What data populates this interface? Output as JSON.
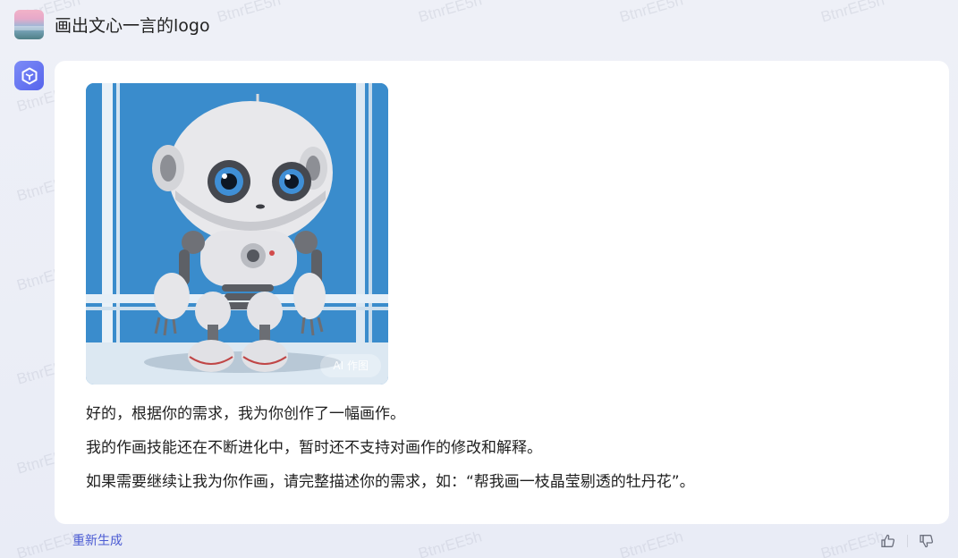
{
  "watermark": {
    "text": "BtnrEE5h"
  },
  "user_message": {
    "text": "画出文心一言的logo"
  },
  "bot_message": {
    "image_badge": "AI 作图",
    "paragraphs": [
      "好的，根据你的需求，我为你创作了一幅画作。",
      "我的作画技能还在不断进化中，暂时还不支持对画作的修改和解释。",
      "如果需要继续让我为你作画，请完整描述你的需求，如：“帮我画一枝晶莹剔透的牡丹花”。"
    ]
  },
  "footer": {
    "regenerate_label": "重新生成",
    "like_icon": "thumbs-up-icon",
    "dislike_icon": "thumbs-down-icon"
  },
  "colors": {
    "accent": "#4b5bd3",
    "bot_avatar": "#6674f0",
    "background": "#eef0f7"
  }
}
